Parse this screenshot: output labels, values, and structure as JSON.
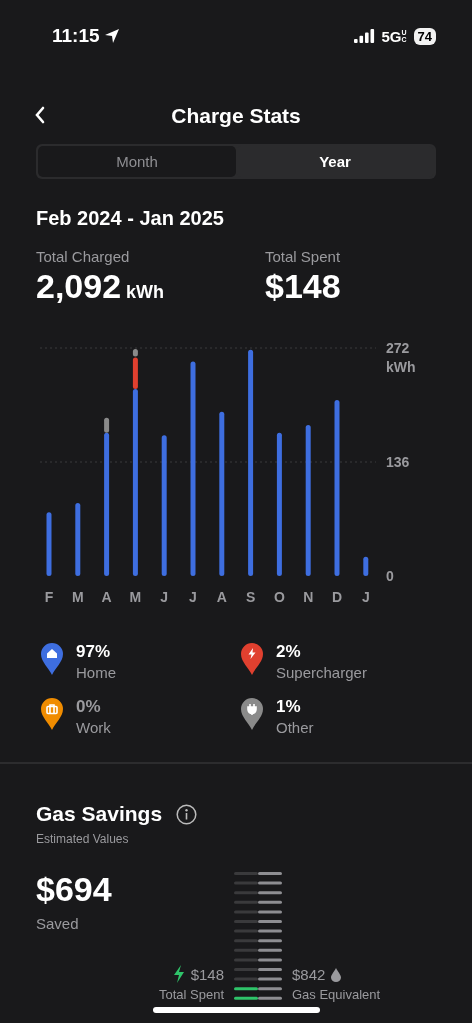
{
  "status_bar": {
    "time": "11:15",
    "network": "5G",
    "network_sub": "UC",
    "battery": "74"
  },
  "nav": {
    "title": "Charge Stats"
  },
  "tabs": [
    {
      "label": "Month",
      "selected": false
    },
    {
      "label": "Year",
      "selected": true
    }
  ],
  "range": "Feb 2024 - Jan 2025",
  "totals": [
    {
      "label": "Total Charged",
      "value": "2,092",
      "unit": "kWh"
    },
    {
      "label": "Total Spent",
      "value": "$148"
    }
  ],
  "chart": {
    "chart_data": {
      "type": "bar",
      "stacked": true,
      "ylabel": "kWh",
      "categories": [
        "F",
        "M",
        "A",
        "M",
        "J",
        "J",
        "A",
        "S",
        "O",
        "N",
        "D",
        "J"
      ],
      "ylim": [
        0,
        272
      ],
      "yticks": [
        0,
        136,
        272
      ],
      "series": [
        {
          "color": "#3e6ee0",
          "values": [
            76,
            87,
            171,
            223,
            168,
            256,
            196,
            270,
            171,
            180,
            210,
            23
          ]
        },
        {
          "color": "#e0402f",
          "values": [
            0,
            0,
            0,
            39,
            0,
            0,
            0,
            0,
            0,
            0,
            0,
            0
          ]
        },
        {
          "color": "#8a8a8a",
          "values": [
            0,
            0,
            19,
            10,
            0,
            0,
            0,
            0,
            0,
            0,
            0,
            0
          ]
        }
      ]
    }
  },
  "legend": [
    {
      "kind": "home",
      "percent": "97%",
      "label": "Home",
      "color": "#3e6ee0",
      "dimmed": false
    },
    {
      "kind": "supercharger",
      "percent": "2%",
      "label": "Supercharger",
      "color": "#e0402f",
      "dimmed": false
    },
    {
      "kind": "work",
      "percent": "0%",
      "label": "Work",
      "color": "#f08c00",
      "dimmed": true
    },
    {
      "kind": "other",
      "percent": "1%",
      "label": "Other",
      "color": "#8a8a8a",
      "dimmed": false
    }
  ],
  "gas_savings": {
    "title": "Gas Savings",
    "subtitle": "Estimated Values",
    "saved_value": "$694",
    "saved_label": "Saved",
    "spent_value": "$148",
    "spent_label": "Total Spent",
    "gas_value": "$842",
    "gas_label": "Gas Equivalent"
  }
}
